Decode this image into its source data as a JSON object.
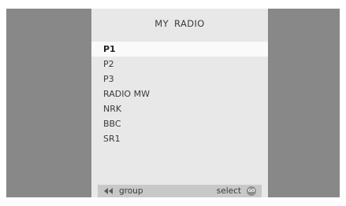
{
  "menu": {
    "title": "MY  RADIO",
    "items": [
      {
        "label": "P1",
        "selected": true
      },
      {
        "label": "P2",
        "selected": false
      },
      {
        "label": "P3",
        "selected": false
      },
      {
        "label": "RADIO MW",
        "selected": false
      },
      {
        "label": "NRK",
        "selected": false
      },
      {
        "label": "BBC",
        "selected": false
      },
      {
        "label": "SR1",
        "selected": false
      }
    ]
  },
  "footer": {
    "back_icon": "double-left-arrow-icon",
    "group_label": "group",
    "select_label": "select",
    "go_icon_label": "GO"
  },
  "colors": {
    "background": "#888888",
    "panel": "#e8e8e8",
    "highlight": "#fafafa",
    "footer_bar": "#c8c8c8"
  }
}
